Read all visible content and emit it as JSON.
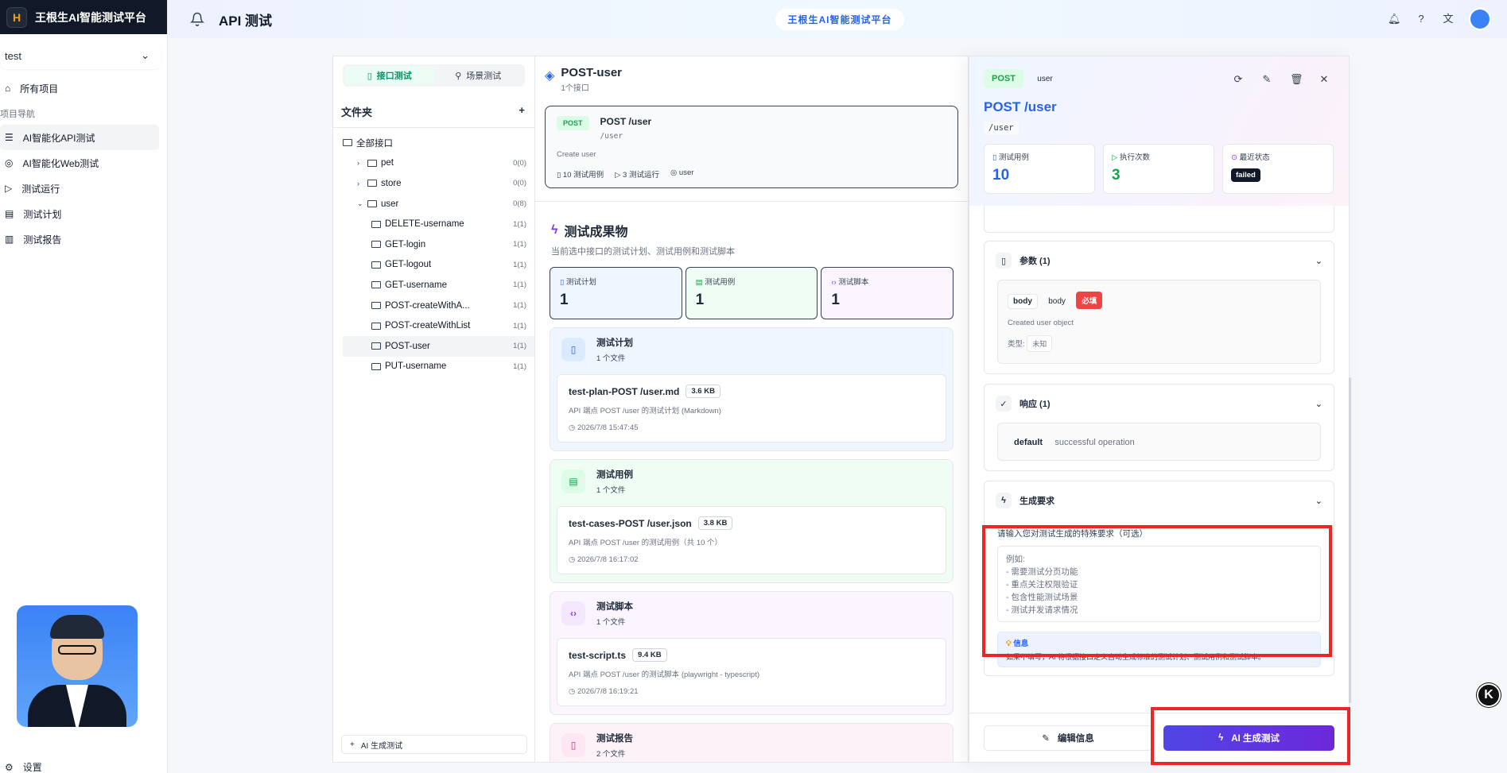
{
  "brand": {
    "title": "王根生AI智能测试平台",
    "logo_glyph": "H"
  },
  "project_select": {
    "value": "test"
  },
  "nav": {
    "all_projects": "所有项目",
    "section_label": "项目导航",
    "items": [
      {
        "label": "AI智能化API测试",
        "icon": "database-icon"
      },
      {
        "label": "AI智能化Web测试",
        "icon": "globe-icon"
      },
      {
        "label": "测试运行",
        "icon": "play-icon"
      },
      {
        "label": "测试计划",
        "icon": "clipboard-icon"
      },
      {
        "label": "测试报告",
        "icon": "bar-chart-icon"
      }
    ],
    "settings": "设置"
  },
  "header": {
    "title": "API 测试",
    "center_badge": "王根生AI智能测试平台"
  },
  "file_panel": {
    "tabs": [
      {
        "label": "接口测试"
      },
      {
        "label": "场景测试"
      }
    ],
    "folder_title": "文件夹",
    "root": "全部接口",
    "groups": [
      {
        "name": "pet",
        "count": "0(0)"
      },
      {
        "name": "store",
        "count": "0(0)"
      },
      {
        "name": "user",
        "count": "0(8)"
      }
    ],
    "user_items": [
      {
        "name": "DELETE-username",
        "count": "1(1)"
      },
      {
        "name": "GET-login",
        "count": "1(1)"
      },
      {
        "name": "GET-logout",
        "count": "1(1)"
      },
      {
        "name": "GET-username",
        "count": "1(1)"
      },
      {
        "name": "POST-createWithA...",
        "count": "1(1)"
      },
      {
        "name": "POST-createWithList",
        "count": "1(1)"
      },
      {
        "name": "POST-user",
        "count": "1(1)"
      },
      {
        "name": "PUT-username",
        "count": "1(1)"
      }
    ],
    "ai_button": "AI 生成测试"
  },
  "middle": {
    "title": "POST-user",
    "subtitle": "1个接口",
    "api_card": {
      "method": "POST",
      "path_title": "POST /user",
      "path": "/user",
      "desc": "Create user",
      "cases": "10 测试用例",
      "runs": "3 测试运行",
      "tag": "user"
    },
    "artifacts_title": "测试成果物",
    "artifacts_sub": "当前选中接口的测试计划、测试用例和测试脚本",
    "stats": [
      {
        "label": "测试计划",
        "value": "1"
      },
      {
        "label": "测试用例",
        "value": "1"
      },
      {
        "label": "测试脚本",
        "value": "1"
      }
    ],
    "blocks": [
      {
        "name": "测试计划",
        "count": "1 个文件",
        "file": "test-plan-POST /user.md",
        "size": "3.6 KB",
        "desc": "API 端点 POST /user 的测试计划 (Markdown)",
        "time": "2026/7/8 15:47:45"
      },
      {
        "name": "测试用例",
        "count": "1 个文件",
        "file": "test-cases-POST /user.json",
        "size": "3.8 KB",
        "desc": "API 端点 POST /user 的测试用例（共 10 个）",
        "time": "2026/7/8 16:17:02"
      },
      {
        "name": "测试脚本",
        "count": "1 个文件",
        "file": "test-script.ts",
        "size": "9.4 KB",
        "desc": "API 端点 POST /user 的测试脚本 (playwright - typescript)",
        "time": "2026/7/8 16:19:21"
      },
      {
        "name": "测试报告",
        "count": "2 个文件"
      }
    ]
  },
  "detail": {
    "method": "POST",
    "tag": "user",
    "title": "POST /user",
    "path": "/user",
    "stats": [
      {
        "label": "测试用例",
        "value": "10"
      },
      {
        "label": "执行次数",
        "value": "3"
      },
      {
        "label": "最近状态",
        "value": "failed"
      }
    ],
    "params": {
      "title": "参数 (1)",
      "name": "body",
      "in": "body",
      "required": "必填",
      "desc": "Created user object",
      "type_label": "类型:",
      "type_value": "未知"
    },
    "response": {
      "title": "响应 (1)",
      "code": "default",
      "desc": "successful operation"
    },
    "gen_req": {
      "title": "生成要求",
      "label": "请输入您对测试生成的特殊要求（可选）",
      "placeholder": "例如:\n- 需要测试分页功能\n- 重点关注权限验证\n- 包含性能测试场景\n- 测试并发请求情况",
      "info_title": "信息",
      "info_text": "如果不填写，AI 将根据接口定义自动生成标准的测试计划、测试用例和测试脚本。"
    },
    "edit_button": "编辑信息",
    "generate_button": "AI 生成测试"
  },
  "k_badge": "K"
}
